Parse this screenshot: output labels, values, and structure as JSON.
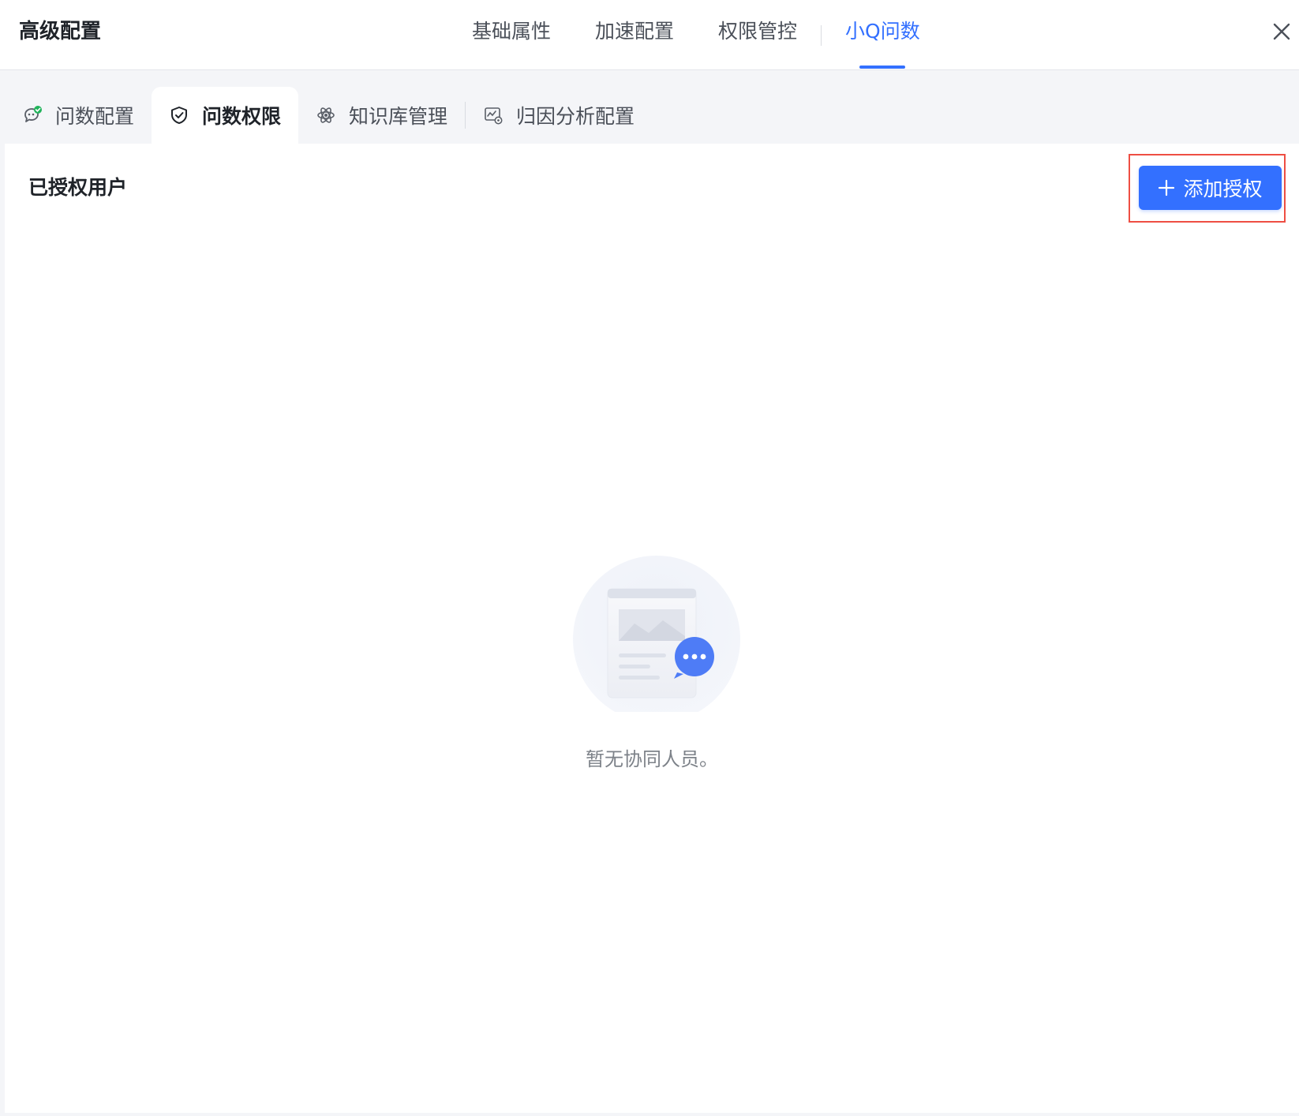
{
  "header": {
    "title": "高级配置",
    "tabs": [
      {
        "label": "基础属性"
      },
      {
        "label": "加速配置"
      },
      {
        "label": "权限管控"
      },
      {
        "label": "小Q问数",
        "active": true
      }
    ],
    "close_icon": "close-icon"
  },
  "sub_tabs": [
    {
      "label": "问数配置",
      "icon": "chat-check-icon"
    },
    {
      "label": "问数权限",
      "icon": "shield-check-icon",
      "active": true
    },
    {
      "label": "知识库管理",
      "icon": "atom-icon"
    },
    {
      "label": "归因分析配置",
      "icon": "chart-settings-icon"
    }
  ],
  "panel": {
    "section_title": "已授权用户",
    "add_button_label": "添加授权",
    "empty_text": "暂无协同人员。"
  },
  "colors": {
    "accent": "#3370ff",
    "highlight_border": "#ee4e43",
    "success_dot": "#21b35b"
  }
}
